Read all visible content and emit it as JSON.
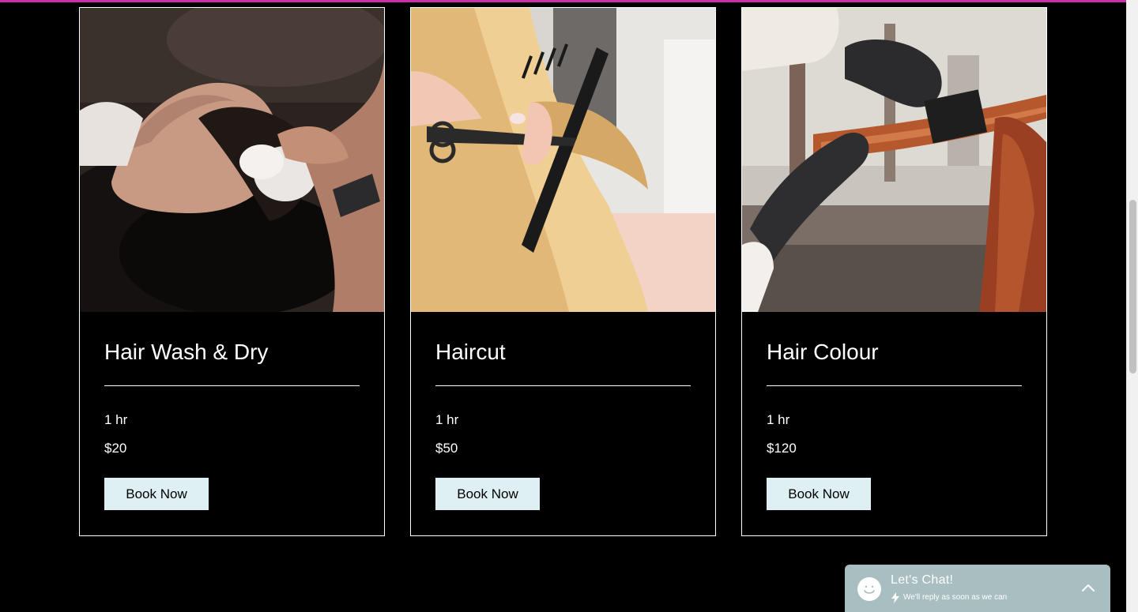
{
  "colors": {
    "accent_bar": "#cc2ea8",
    "button_bg": "#def0f3",
    "chat_bg": "#a9bec1"
  },
  "services": [
    {
      "title": "Hair Wash & Dry",
      "duration": "1 hr",
      "price": "$20",
      "button_label": "Book Now",
      "image_icon": "hair-wash-photo"
    },
    {
      "title": "Haircut",
      "duration": "1 hr",
      "price": "$50",
      "button_label": "Book Now",
      "image_icon": "haircut-photo"
    },
    {
      "title": "Hair Colour",
      "duration": "1 hr",
      "price": "$120",
      "button_label": "Book Now",
      "image_icon": "hair-colour-photo"
    }
  ],
  "chat": {
    "title": "Let's Chat!",
    "subtitle": "We'll reply as soon as we can",
    "avatar_icon": "smiley-icon",
    "bolt_icon": "lightning-icon",
    "toggle_icon": "chevron-up-icon"
  }
}
